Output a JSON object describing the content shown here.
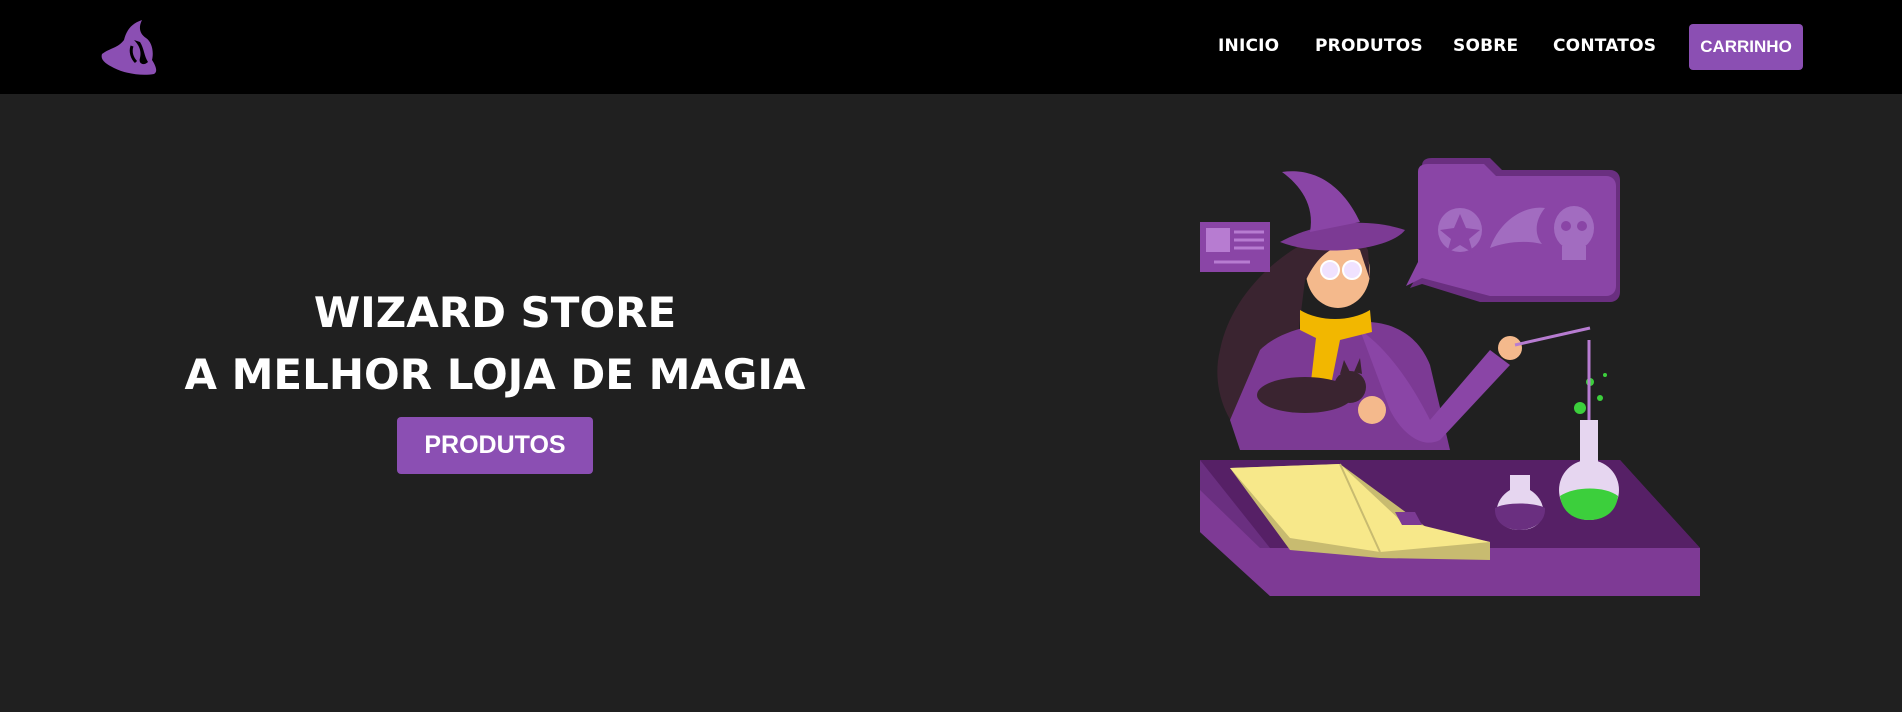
{
  "nav": {
    "logo_icon": "witch-hat-logo-icon",
    "links": [
      "INICIO",
      "PRODUTOS",
      "SOBRE",
      "CONTATOS"
    ],
    "cart_label": "CARRINHO"
  },
  "hero": {
    "title": "WIZARD STORE",
    "subtitle": "A MELHOR LOJA DE MAGIA",
    "button_label": "PRODUTOS",
    "illustration_icon": "witch-with-potions-illustration"
  },
  "colors": {
    "accent": "#8b4fb3",
    "navbar_bg": "#000000",
    "page_bg": "#202020",
    "text": "#ffffff"
  }
}
